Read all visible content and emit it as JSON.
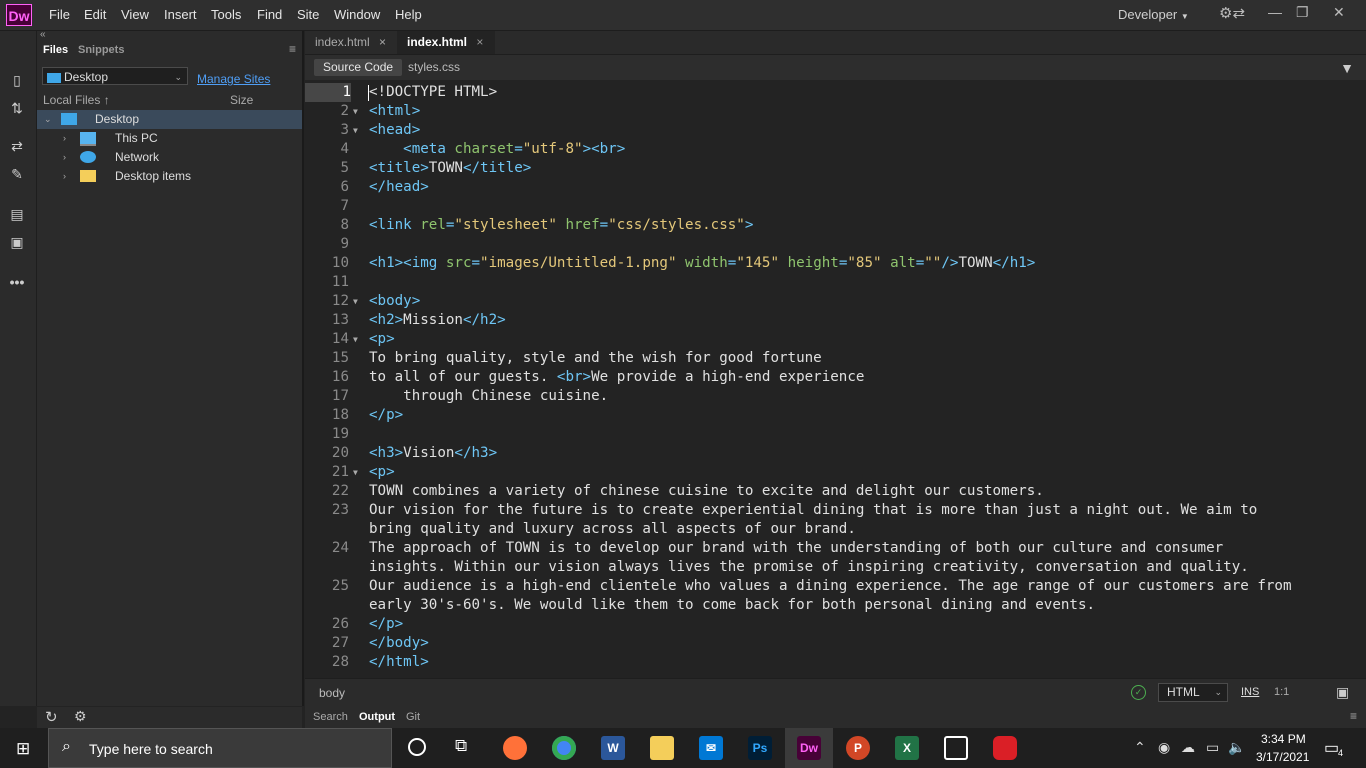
{
  "menubar": {
    "logo": "Dw",
    "items": [
      "File",
      "Edit",
      "View",
      "Insert",
      "Tools",
      "Find",
      "Site",
      "Window",
      "Help"
    ],
    "workspace": "Developer"
  },
  "files_panel": {
    "collapse_glyph": "«",
    "tabs": [
      "Files",
      "Snippets"
    ],
    "site_selected": "Desktop",
    "manage_sites": "Manage Sites",
    "col_local": "Local Files",
    "col_size": "Size",
    "tree": [
      {
        "label": "Desktop",
        "icon": "desktop-icon",
        "selected": true,
        "expanded": true
      },
      {
        "label": "This PC",
        "icon": "this-pc-icon"
      },
      {
        "label": "Network",
        "icon": "network-icon"
      },
      {
        "label": "Desktop items",
        "icon": "folder-icon"
      }
    ]
  },
  "doc_tabs": [
    {
      "label": "index.html",
      "close": "×"
    },
    {
      "label": "index.html",
      "close": "×",
      "active": true
    }
  ],
  "related_files": [
    "Source Code",
    "styles.css"
  ],
  "code_lines": [
    {
      "n": "1",
      "parts": [
        [
          "txt",
          "<!DOCTYPE HTML>"
        ]
      ]
    },
    {
      "n": "2",
      "fold": true,
      "parts": [
        [
          "tag",
          "<html>"
        ]
      ]
    },
    {
      "n": "3",
      "fold": true,
      "parts": [
        [
          "tag",
          "<head>"
        ]
      ]
    },
    {
      "n": "4",
      "parts": [
        [
          "txt",
          "    "
        ],
        [
          "tag",
          "<meta "
        ],
        [
          "attr",
          "charset"
        ],
        [
          "tag",
          "="
        ],
        [
          "str",
          "\"utf-8\""
        ],
        [
          "tag",
          "><br>"
        ]
      ]
    },
    {
      "n": "5",
      "parts": [
        [
          "tag",
          "<title>"
        ],
        [
          "txt",
          "TOWN"
        ],
        [
          "tag",
          "</title>"
        ]
      ]
    },
    {
      "n": "6",
      "parts": [
        [
          "tag",
          "</head>"
        ]
      ]
    },
    {
      "n": "7",
      "parts": []
    },
    {
      "n": "8",
      "parts": [
        [
          "tag",
          "<link "
        ],
        [
          "attr",
          "rel"
        ],
        [
          "tag",
          "="
        ],
        [
          "str",
          "\"stylesheet\""
        ],
        [
          "attr",
          " href"
        ],
        [
          "tag",
          "="
        ],
        [
          "str",
          "\"css/styles.css\""
        ],
        [
          "tag",
          ">"
        ]
      ]
    },
    {
      "n": "9",
      "parts": []
    },
    {
      "n": "10",
      "parts": [
        [
          "tag",
          "<h1><img "
        ],
        [
          "attr",
          "src"
        ],
        [
          "tag",
          "="
        ],
        [
          "str",
          "\"images/Untitled-1.png\""
        ],
        [
          "attr",
          " width"
        ],
        [
          "tag",
          "="
        ],
        [
          "str",
          "\"145\""
        ],
        [
          "attr",
          " height"
        ],
        [
          "tag",
          "="
        ],
        [
          "str",
          "\"85\""
        ],
        [
          "attr",
          " alt"
        ],
        [
          "tag",
          "="
        ],
        [
          "str",
          "\"\""
        ],
        [
          "tag",
          "/>"
        ],
        [
          "txt",
          "TOWN"
        ],
        [
          "tag",
          "</h1>"
        ]
      ]
    },
    {
      "n": "11",
      "parts": []
    },
    {
      "n": "12",
      "fold": true,
      "parts": [
        [
          "tag",
          "<body>"
        ]
      ]
    },
    {
      "n": "13",
      "parts": [
        [
          "tag",
          "<h2>"
        ],
        [
          "txt",
          "Mission"
        ],
        [
          "tag",
          "</h2>"
        ]
      ]
    },
    {
      "n": "14",
      "fold": true,
      "parts": [
        [
          "tag",
          "<p>"
        ]
      ]
    },
    {
      "n": "15",
      "parts": [
        [
          "txt",
          "To bring quality, style and the wish for good fortune"
        ]
      ]
    },
    {
      "n": "16",
      "parts": [
        [
          "txt",
          "to all of our guests. "
        ],
        [
          "tag",
          "<br>"
        ],
        [
          "txt",
          "We provide a high-end experience"
        ]
      ]
    },
    {
      "n": "17",
      "parts": [
        [
          "txt",
          "    through Chinese cuisine."
        ]
      ]
    },
    {
      "n": "18",
      "parts": [
        [
          "tag",
          "</p>"
        ]
      ]
    },
    {
      "n": "19",
      "parts": []
    },
    {
      "n": "20",
      "parts": [
        [
          "tag",
          "<h3>"
        ],
        [
          "txt",
          "Vision"
        ],
        [
          "tag",
          "</h3>"
        ]
      ]
    },
    {
      "n": "21",
      "fold": true,
      "parts": [
        [
          "tag",
          "<p>"
        ]
      ]
    },
    {
      "n": "22",
      "parts": [
        [
          "txt",
          "TOWN combines a variety of chinese cuisine to excite and delight our customers."
        ]
      ]
    },
    {
      "n": "23",
      "parts": [
        [
          "txt",
          "Our vision for the future is to create experiential dining that is more than just a night out. We aim to"
        ]
      ]
    },
    {
      "n": "",
      "parts": [
        [
          "txt",
          "bring quality and luxury across all aspects of our brand."
        ]
      ]
    },
    {
      "n": "24",
      "parts": [
        [
          "txt",
          "The approach of TOWN is to develop our brand with the understanding of both our culture and consumer"
        ]
      ]
    },
    {
      "n": "",
      "parts": [
        [
          "txt",
          "insights. Within our vision always lives the promise of inspiring creativity, conversation and quality."
        ]
      ]
    },
    {
      "n": "25",
      "parts": [
        [
          "txt",
          "Our audience is a high-end clientele who values a dining experience. The age range of our customers are from"
        ]
      ]
    },
    {
      "n": "",
      "parts": [
        [
          "txt",
          "early 30's-60's. We would like them to come back for both personal dining and events."
        ]
      ]
    },
    {
      "n": "26",
      "parts": [
        [
          "tag",
          "</p>"
        ]
      ]
    },
    {
      "n": "27",
      "parts": [
        [
          "tag",
          "</body>"
        ]
      ]
    },
    {
      "n": "28",
      "parts": [
        [
          "tag",
          "</html>"
        ]
      ]
    }
  ],
  "status": {
    "tag": "body",
    "doc_type": "HTML",
    "mode": "INS",
    "position": "1:1"
  },
  "bottom_tabs": [
    "Search",
    "Output",
    "Git"
  ],
  "taskbar": {
    "search_placeholder": "Type here to search",
    "time": "3:34 PM",
    "date": "3/17/2021",
    "notifications": "4"
  }
}
